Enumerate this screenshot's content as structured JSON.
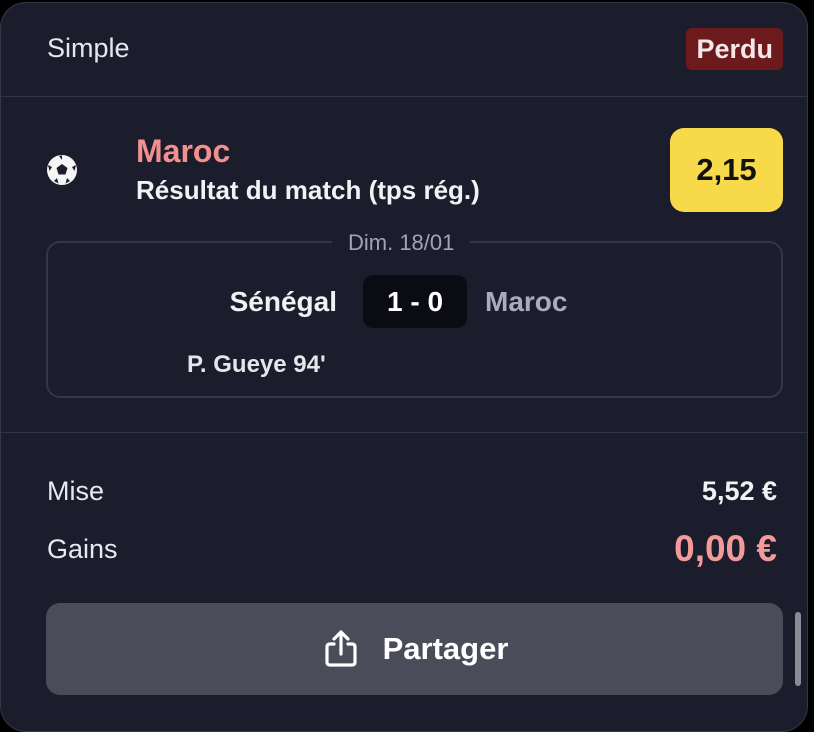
{
  "header": {
    "bet_type": "Simple",
    "status": "Perdu"
  },
  "selection": {
    "sport_icon": "soccer-ball-icon",
    "team": "Maroc",
    "market": "Résultat du match (tps rég.)",
    "odds": "2,15"
  },
  "match": {
    "date": "Dim. 18/01",
    "home_team": "Sénégal",
    "score": "1 - 0",
    "away_team": "Maroc",
    "scorer": "P. Gueye 94'"
  },
  "summary": {
    "stake_label": "Mise",
    "stake_value": "5,52 €",
    "winnings_label": "Gains",
    "winnings_value": "0,00 €"
  },
  "actions": {
    "share_label": "Partager",
    "share_icon": "share-icon"
  },
  "colors": {
    "card_bg": "#1b1d2c",
    "lost_badge": "#6d1a1c",
    "odds_bg": "#f8d94a",
    "loss_text": "#f39a9a"
  }
}
